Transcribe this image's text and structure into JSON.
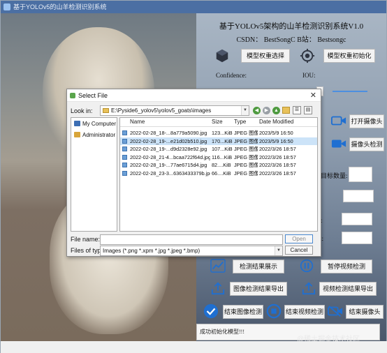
{
  "app": {
    "window_title": "基于YOLOv5的山羊检测识别系统"
  },
  "right_panel": {
    "title": "基于YOLOv5架构的山羊检测识别系统V1.0",
    "csdn_line": "CSDN： BestSongC   B站： Bestsongc",
    "buttons": {
      "model_select": "模型权重选择",
      "model_init": "模型权重初始化",
      "open_camera": "打开摄像头",
      "camera_detect": "摄像头检测",
      "result_display": "检测结果展示",
      "pause_video": "暂停视频检测",
      "export_image_result": "图像检测结果导出",
      "export_video_result": "视频检测结果导出",
      "end_image_detect": "结束图像检测",
      "end_video_detect": "结束视频检测",
      "end_camera": "结束摄像头"
    },
    "labels": {
      "confidence": "Confidence:",
      "iou": "IOU:",
      "target_count": "目标数量:",
      "label_th": "th:",
      "label_ax": "ax:"
    },
    "status_text": "成功初始化模型!!!"
  },
  "watermark": "@稀土掘金技术社区",
  "dialog": {
    "title": "Select File",
    "close_glyph": "✕",
    "look_in_label": "Look in:",
    "look_in_path": "E:\\Pyside6_yolov5\\yolov5_goats\\images",
    "sidebar": [
      {
        "label": "My Computer",
        "color": "#3d6fb4"
      },
      {
        "label": "Administrator",
        "color": "#d8a53a"
      }
    ],
    "columns": {
      "name": "Name",
      "size": "Size",
      "type": "Type",
      "date": "Date Modified"
    },
    "files": [
      {
        "name": "2022-02-28_18-...8a779a5090.jpg",
        "size": "123...KiB",
        "type": "JPEG 图像",
        "date": "2023/5/9 16:50",
        "selected": false
      },
      {
        "name": "2022-02-28_19-...e21d02b510.jpg",
        "size": "170...KiB",
        "type": "JPEG 图像",
        "date": "2023/5/9 16:50",
        "selected": true
      },
      {
        "name": "2022-02-28_19-...d9d2328e92.jpg",
        "size": "107...KiB",
        "type": "JPEG 图像",
        "date": "2022/3/26 18:57",
        "selected": false
      },
      {
        "name": "2022-02-28_21-4...bcaa722f64d.jpg",
        "size": "116...KiB",
        "type": "JPEG 图像",
        "date": "2022/3/26 18:57",
        "selected": false
      },
      {
        "name": "2022-02-28_19-...77ae6715d4.jpg",
        "size": "82....KiB",
        "type": "JPEG 图像",
        "date": "2022/3/26 18:57",
        "selected": false
      },
      {
        "name": "2022-02-28_23-3...6363433379b.jpg",
        "size": "66....KiB",
        "type": "JPEG 图像",
        "date": "2022/3/26 18:57",
        "selected": false
      }
    ],
    "file_name_label": "File name:",
    "file_name_value": "",
    "files_of_type_label": "Files of type:",
    "files_of_type_value": "Images (*.png *.xpm *.jpg *.jpeg *.bmp)",
    "open_button": "Open",
    "cancel_button": "Cancel"
  },
  "colors": {
    "accent_blue": "#1f6fd1",
    "title_bar": "#4b6fa3",
    "selection": "#cce3f8"
  }
}
